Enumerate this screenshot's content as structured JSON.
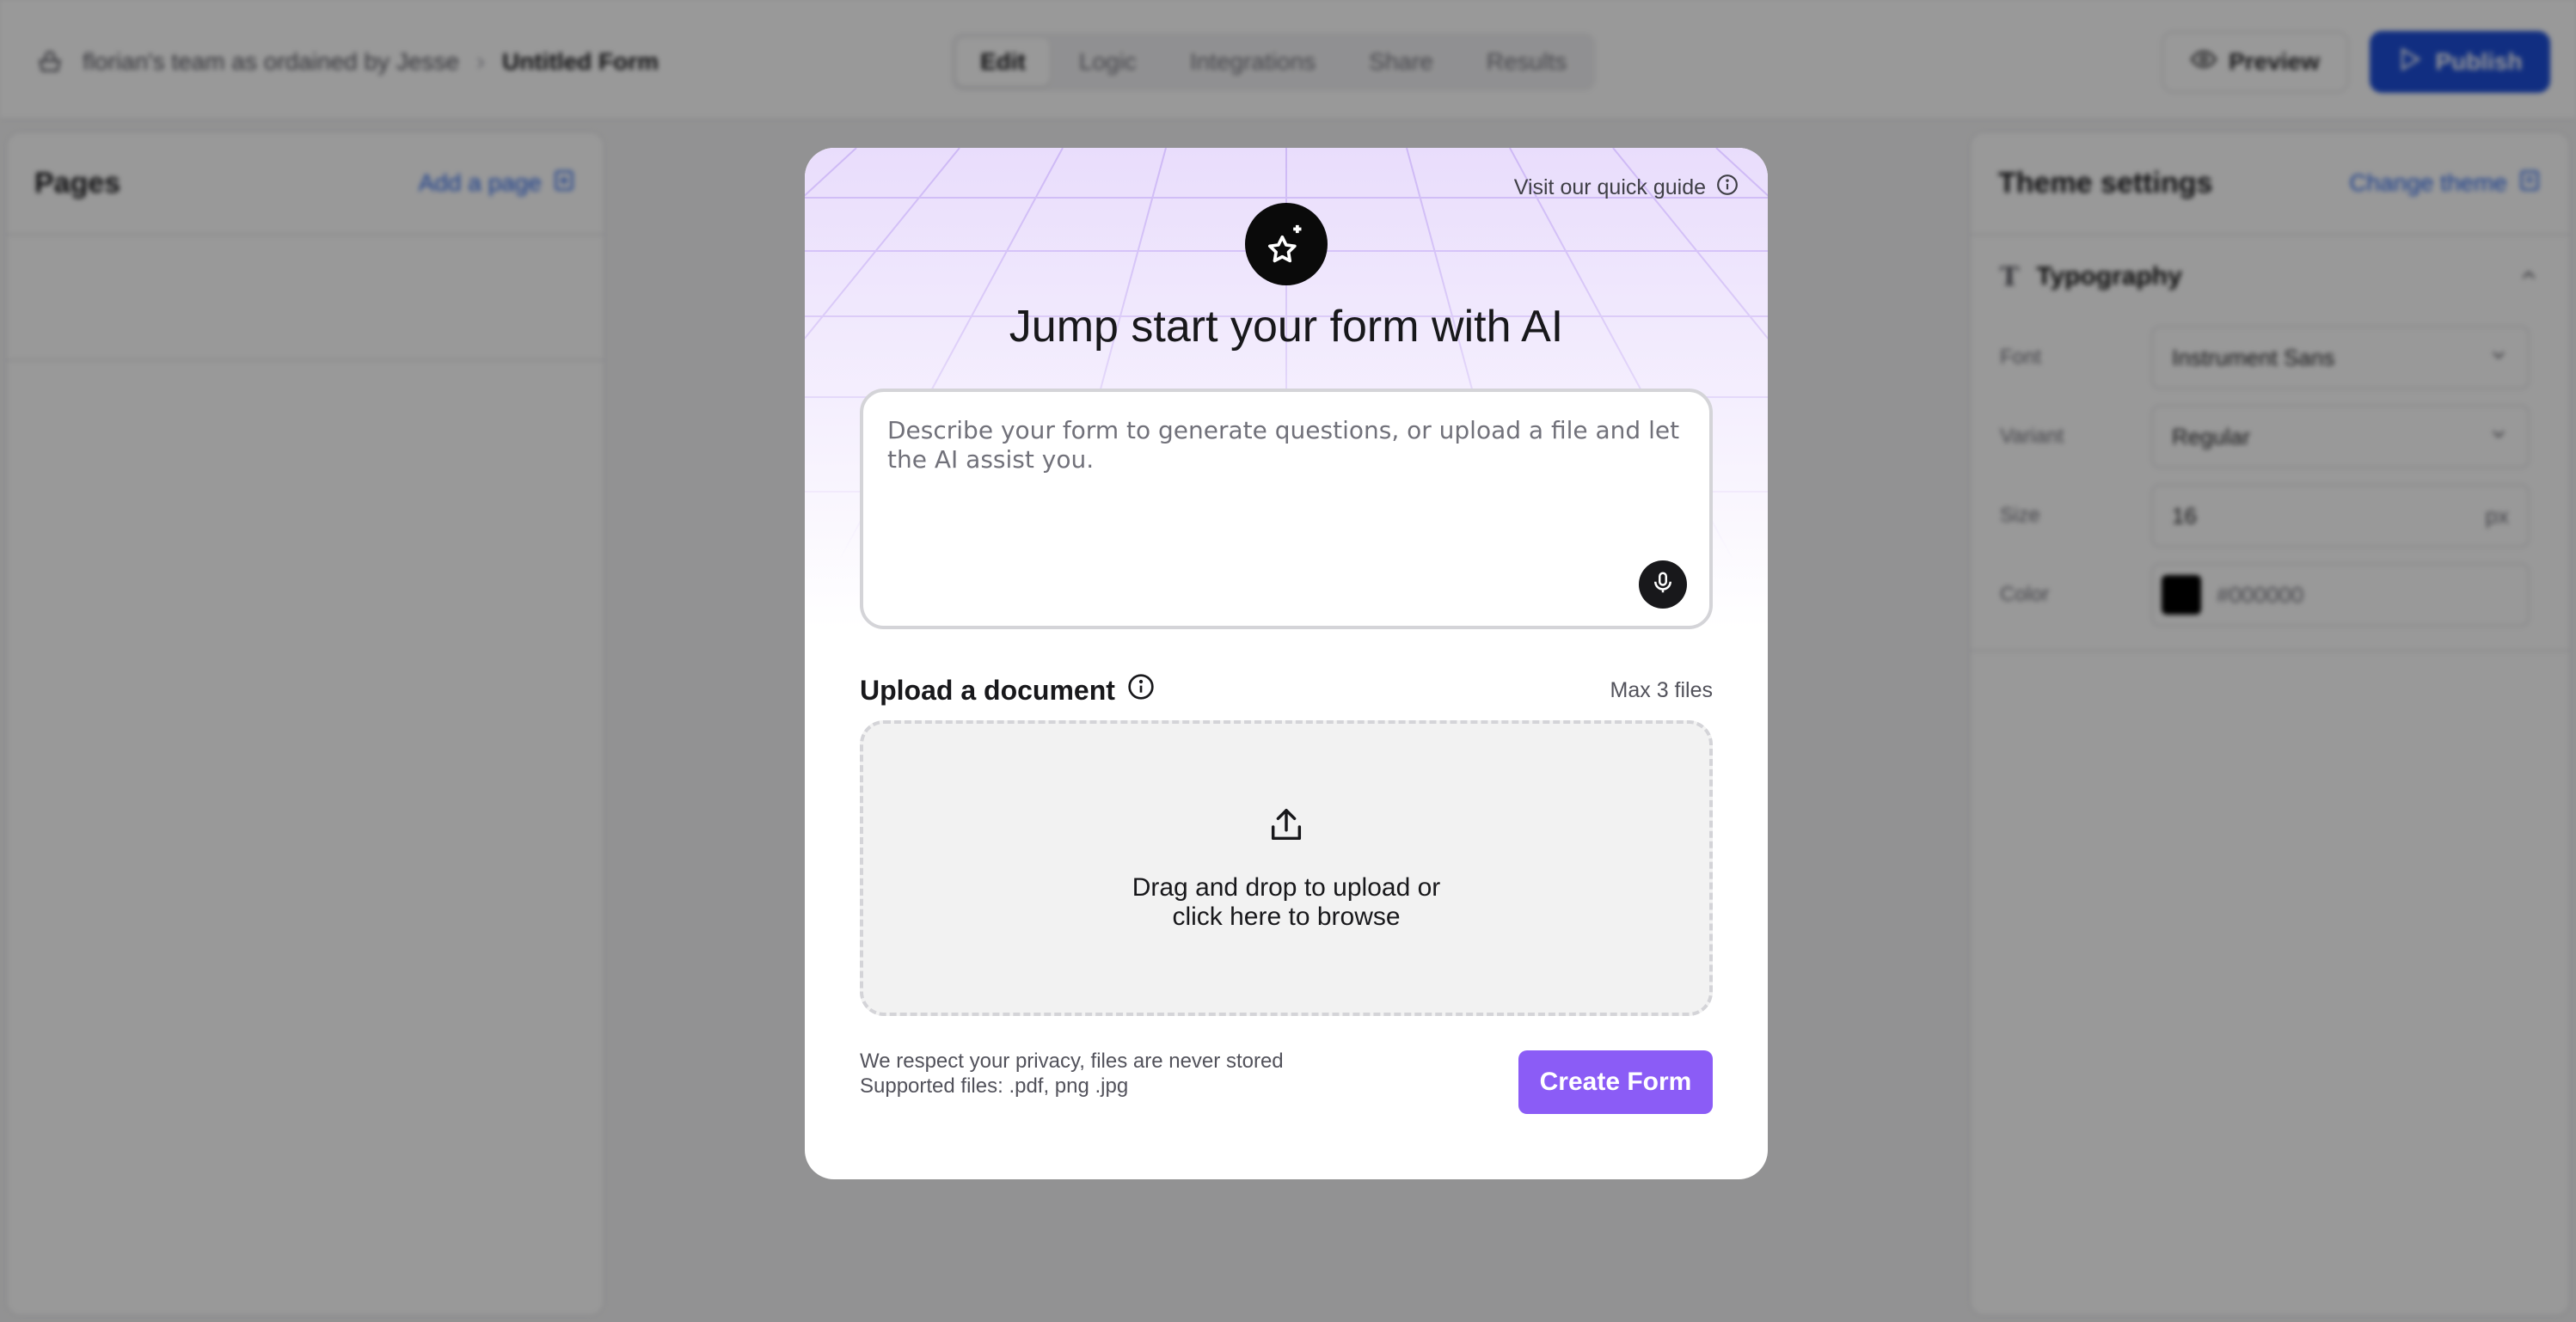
{
  "header": {
    "team": "florian's team as ordained by Jesse",
    "form_title": "Untitled Form",
    "tabs": [
      "Edit",
      "Logic",
      "Integrations",
      "Share",
      "Results"
    ],
    "active_tab": "Edit",
    "preview_label": "Preview",
    "publish_label": "Publish"
  },
  "pages_panel": {
    "title": "Pages",
    "add_label": "Add a page"
  },
  "theme_panel": {
    "title": "Theme settings",
    "change_label": "Change theme",
    "section": "Typography",
    "rows": [
      {
        "label": "Font",
        "value": "Instrument Sans"
      },
      {
        "label": "Variant",
        "value": "Regular"
      },
      {
        "label": "Size",
        "value": "16",
        "unit": "px"
      },
      {
        "label": "Color",
        "value": "#000000"
      }
    ]
  },
  "modal": {
    "guide_link": "Visit our quick guide",
    "title": "Jump start your form with AI",
    "prompt_placeholder": "Describe your form to generate questions, or upload a file and let the AI assist you.",
    "upload_title": "Upload a document",
    "max_files": "Max 3 files",
    "drop_line1": "Drag and drop to upload or",
    "drop_line2": "click here to browse",
    "privacy_line1": "We respect your privacy, files are never stored",
    "privacy_line2": "Supported files: .pdf, png .jpg",
    "create_label": "Create Form"
  },
  "colors": {
    "accent": "#8b5cf6",
    "publish": "#1d4ed8",
    "link": "#2563eb",
    "grid_tint": "#e9ddfc"
  },
  "icons": [
    "team-icon",
    "chevron-right-icon",
    "eye-icon",
    "send-icon",
    "add-page-icon",
    "palette-icon",
    "typography-icon",
    "chevron-up-icon",
    "chevron-down-icon",
    "info-icon",
    "sparkle-star-icon",
    "mic-icon",
    "upload-icon"
  ]
}
